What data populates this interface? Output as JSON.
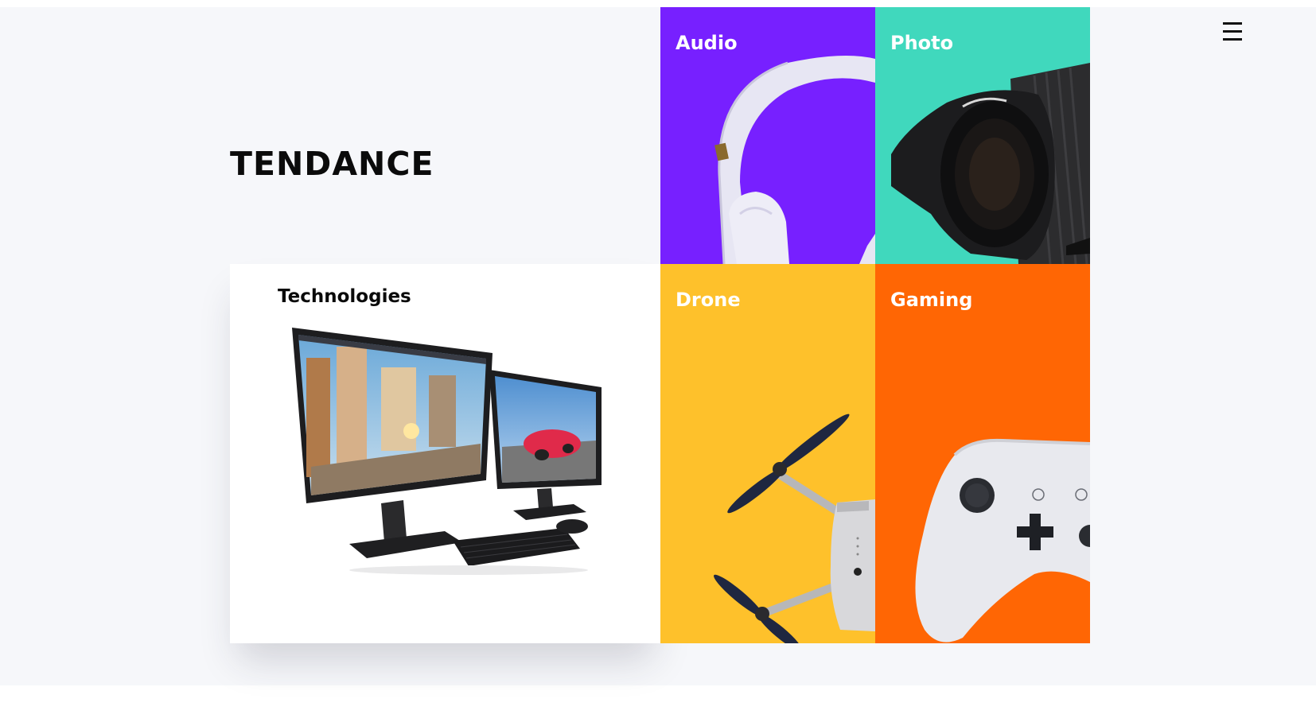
{
  "section": {
    "title": "TENDANCE"
  },
  "menu": {
    "icon": "hamburger-menu-icon"
  },
  "categories": [
    {
      "label": "Technologies",
      "icon": "dual-monitor-computer-image",
      "color": "#ffffff"
    },
    {
      "label": "Audio",
      "icon": "headphones-image",
      "color": "#7720ff"
    },
    {
      "label": "Photo",
      "icon": "camera-lens-image",
      "color": "#40d8bd"
    },
    {
      "label": "Drone",
      "icon": "drone-image",
      "color": "#fec12b"
    },
    {
      "label": "Gaming",
      "icon": "game-controller-image",
      "color": "#ff6604"
    }
  ]
}
